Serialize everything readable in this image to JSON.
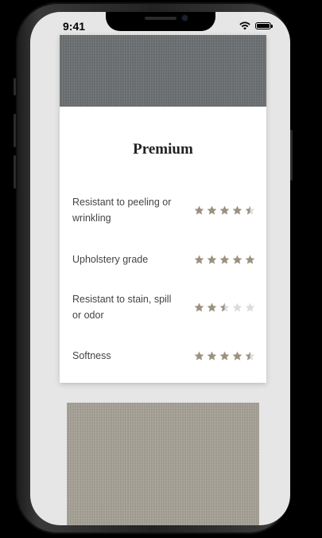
{
  "status_bar": {
    "time": "9:41"
  },
  "card": {
    "title": "Premium",
    "attributes": [
      {
        "label": "Resistant to peeling or wrinkling",
        "rating": 4.5,
        "max": 5
      },
      {
        "label": "Upholstery grade",
        "rating": 5,
        "max": 5
      },
      {
        "label": "Resistant to stain, spill or odor",
        "rating": 2.5,
        "max": 5
      },
      {
        "label": "Softness",
        "rating": 4.5,
        "max": 5
      }
    ]
  },
  "colors": {
    "star_filled": "#9b917f",
    "star_empty": "#dcdcdc",
    "swatch_top": "#6d7173",
    "swatch_bottom": "#a8a397"
  },
  "icons": [
    "wifi-icon",
    "battery-icon",
    "star-icon"
  ]
}
